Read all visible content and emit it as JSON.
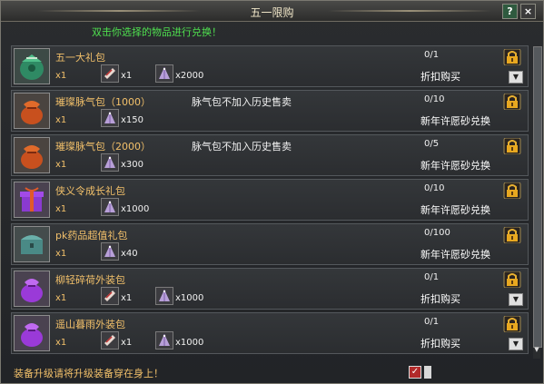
{
  "window": {
    "title": "五一限购",
    "help_label": "?",
    "close_label": "×"
  },
  "hint": "双击你选择的物品进行兑换！",
  "items": [
    {
      "name": "五一大礼包",
      "note": "",
      "qty": "x1",
      "icon": "green-gift-box-icon",
      "costs": [
        {
          "icon": "scroll-ticket-icon",
          "value": "x1"
        },
        {
          "icon": "sand-pyramid-icon",
          "value": "x2000"
        }
      ],
      "count": "0/1",
      "action": "折扣购买",
      "has_dropdown": true
    },
    {
      "name": "璀璨脉气包（1000）",
      "note": "脉气包不加入历史售卖",
      "qty": "x1",
      "icon": "orange-pouch-icon",
      "costs": [
        {
          "icon": "sand-pyramid-icon",
          "value": "x150"
        }
      ],
      "count": "0/10",
      "action": "新年许愿砂兑换",
      "has_dropdown": false
    },
    {
      "name": "璀璨脉气包（2000）",
      "note": "脉气包不加入历史售卖",
      "qty": "x1",
      "icon": "orange-pouch-icon",
      "costs": [
        {
          "icon": "sand-pyramid-icon",
          "value": "x300"
        }
      ],
      "count": "0/5",
      "action": "新年许愿砂兑换",
      "has_dropdown": false
    },
    {
      "name": "侠义令成长礼包",
      "note": "",
      "qty": "x1",
      "icon": "purple-gift-box-icon",
      "costs": [
        {
          "icon": "sand-pyramid-icon",
          "value": "x1000"
        }
      ],
      "count": "0/10",
      "action": "新年许愿砂兑换",
      "has_dropdown": false
    },
    {
      "name": "pk药品超值礼包",
      "note": "",
      "qty": "x1",
      "icon": "teal-chest-icon",
      "costs": [
        {
          "icon": "sand-pyramid-icon",
          "value": "x40"
        }
      ],
      "count": "0/100",
      "action": "新年许愿砂兑换",
      "has_dropdown": false
    },
    {
      "name": "柳轻碎荷外装包",
      "note": "",
      "qty": "x1",
      "icon": "purple-pouch-icon",
      "costs": [
        {
          "icon": "scroll-ticket-icon",
          "value": "x1"
        },
        {
          "icon": "sand-pyramid-icon",
          "value": "x1000"
        }
      ],
      "count": "0/1",
      "action": "折扣购买",
      "has_dropdown": true
    },
    {
      "name": "遥山暮雨外装包",
      "note": "",
      "qty": "x1",
      "icon": "purple-pouch-icon",
      "costs": [
        {
          "icon": "scroll-ticket-icon",
          "value": "x1"
        },
        {
          "icon": "sand-pyramid-icon",
          "value": "x1000"
        }
      ],
      "count": "0/1",
      "action": "折扣购买",
      "has_dropdown": true
    }
  ],
  "footer": {
    "text": "装备升级请将升级装备穿在身上！",
    "checkbox_checked": true
  },
  "colors": {
    "hint": "#4fe04f",
    "item_name": "#f2c06a",
    "title": "#f0e6c8"
  }
}
